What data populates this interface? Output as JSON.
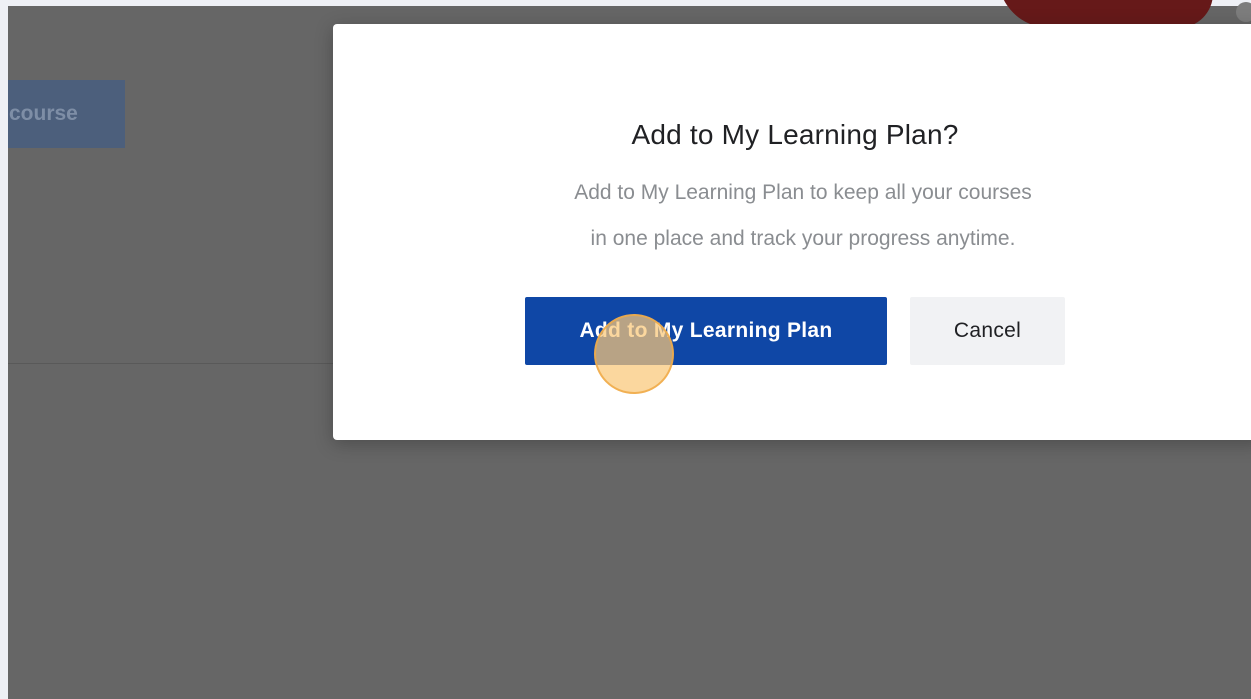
{
  "background": {
    "course_button_label": "course"
  },
  "dialog": {
    "title": "Add to My Learning Plan?",
    "body_line_1": "Add to My Learning Plan to keep all your courses",
    "body_line_2": "in one place and track your progress anytime.",
    "primary_button_label": "Add to My Learning Plan",
    "cancel_button_label": "Cancel"
  },
  "colors": {
    "primary_button": "#0f47a6",
    "overlay": "#666666",
    "click_indicator": "#f9c878"
  }
}
